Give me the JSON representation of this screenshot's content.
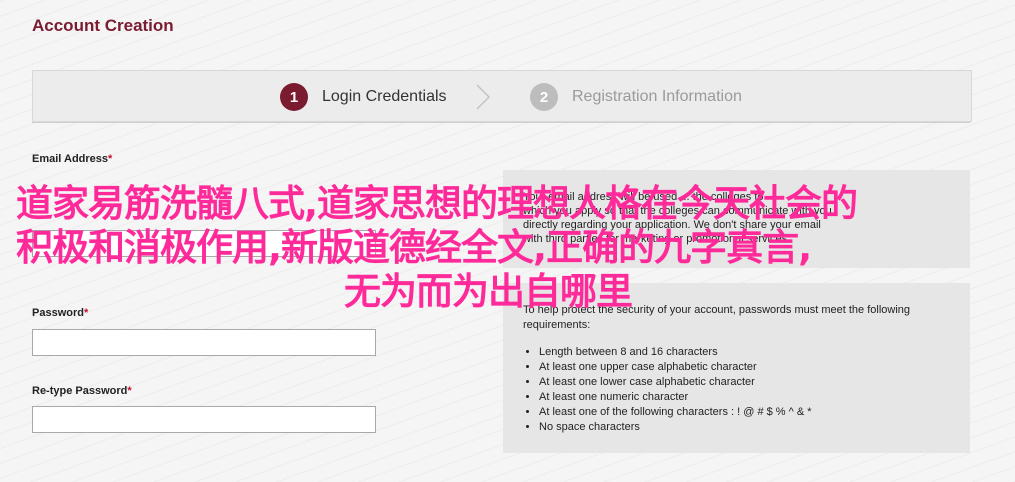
{
  "header": {
    "title": "Account Creation"
  },
  "steps": [
    {
      "number": "1",
      "label": "Login Credentials"
    },
    {
      "number": "2",
      "label": "Registration Information"
    }
  ],
  "form": {
    "email_label": "Email Address",
    "password_label": "Password",
    "retype_label": "Re-type Password",
    "required_mark": "*",
    "email_value": "",
    "password_value": "",
    "retype_value": ""
  },
  "email_info": {
    "lines": [
      "Your email address will be used ... the colleges to",
      "which you apply so that the colleges can communicate with you",
      "directly regarding your application. We don't share your email",
      "with third parties for marketing or promotional services."
    ]
  },
  "password_info": {
    "intro": "To help protect the security of your account, passwords must meet the following requirements:",
    "requirements": [
      "Length between 8 and 16 characters",
      "At least one upper case alphabetic character",
      "At least one lower case alphabetic character",
      "At least one numeric character",
      "At least one of the following characters : ! @ # $ % ^ & *",
      "No space characters"
    ]
  },
  "overlay_text": {
    "line1": "道家易筋洗髓八式,道家思想的理想人格在今天社会的",
    "line2": "积极和消极作用,新版道德经全文,正确的九字真言,",
    "line3": "无为而为出自哪里"
  },
  "colors": {
    "brand": "#7a1b30",
    "overlay": "#ff2a9a",
    "inactive_step": "#bdbdbd"
  }
}
